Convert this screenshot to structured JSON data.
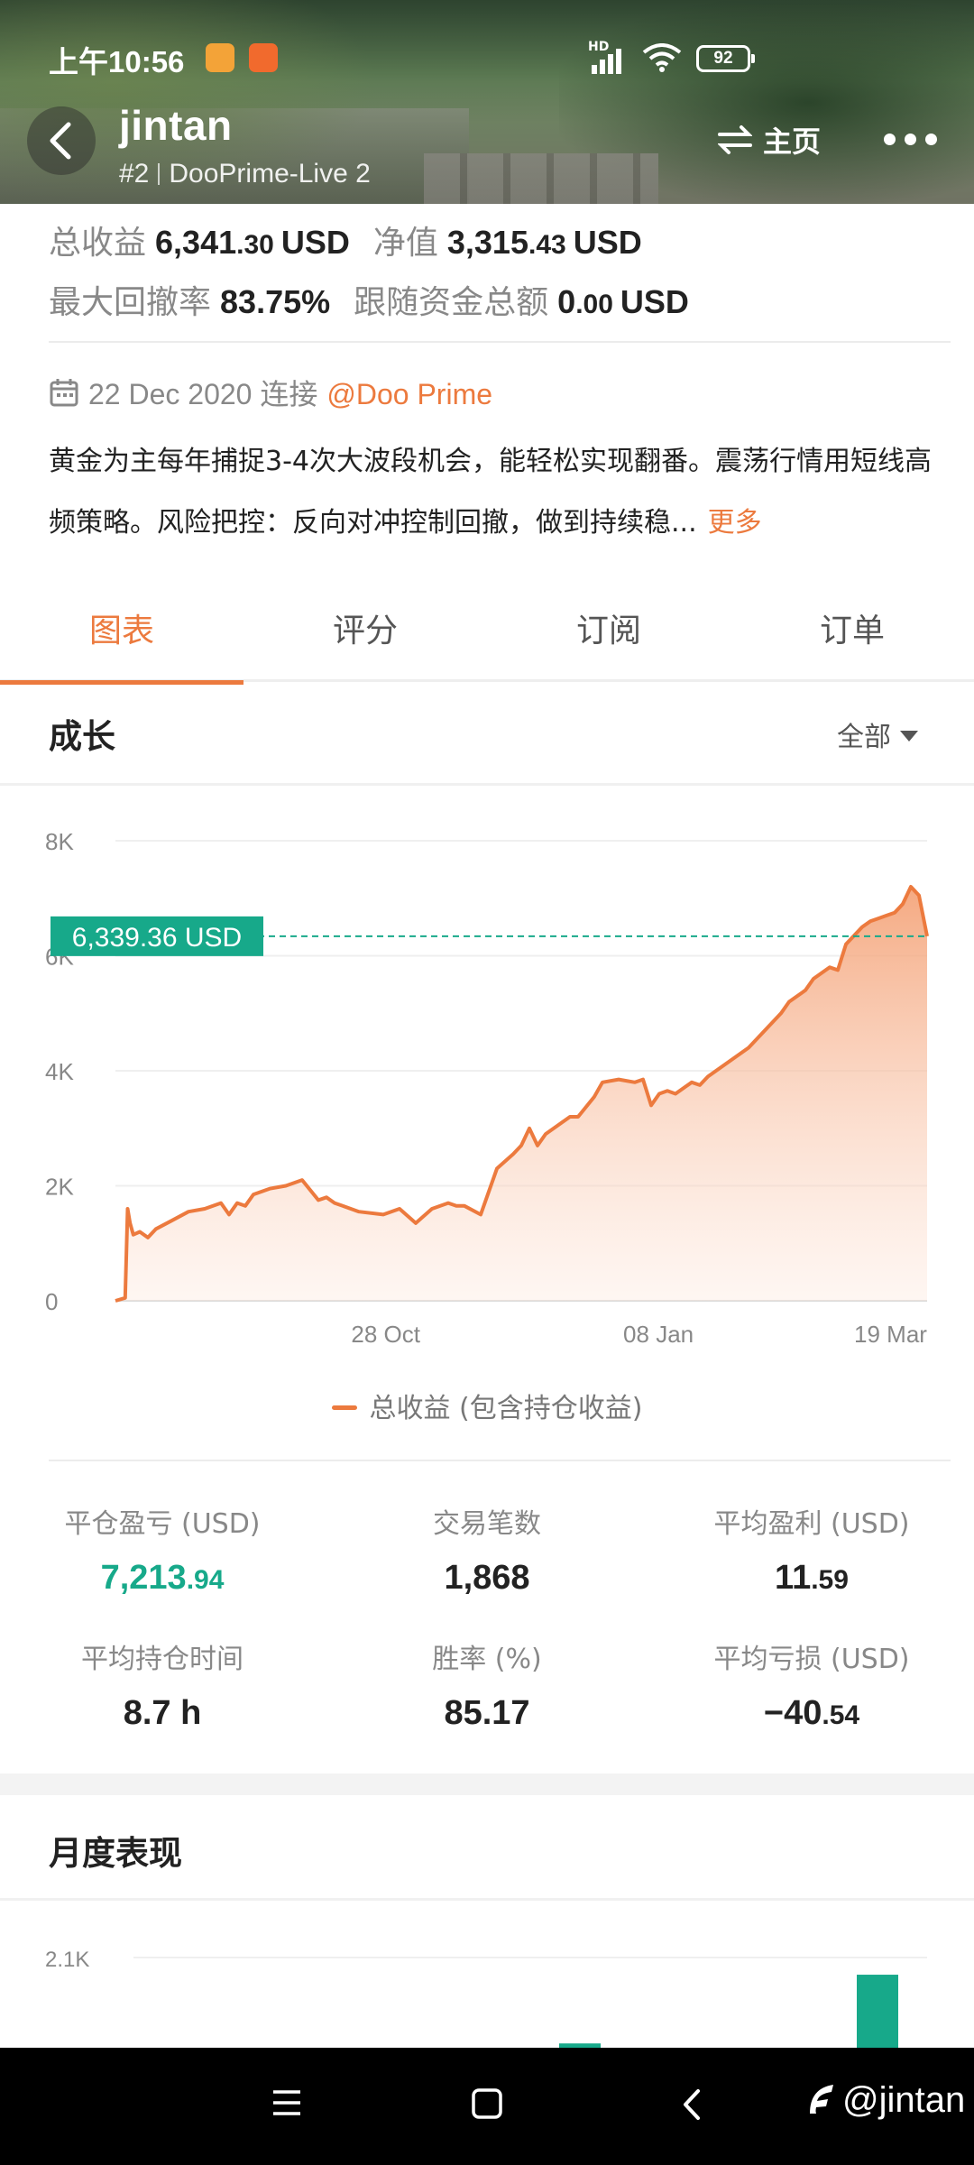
{
  "status_bar": {
    "time": "上午10:56",
    "hd": "HD",
    "battery": "92"
  },
  "header": {
    "name": "jintan",
    "rank": "#2",
    "account": "DooPrime-Live 2",
    "home_label": "主页"
  },
  "summary": {
    "total_profit_label": "总收益",
    "total_profit_int": "6,341",
    "total_profit_dec": ".30",
    "total_profit_unit": "USD",
    "equity_label": "净值",
    "equity_int": "3,315",
    "equity_dec": ".43",
    "equity_unit": "USD",
    "max_drawdown_label": "最大回撤率",
    "max_drawdown": "83.75%",
    "follow_funds_label": "跟随资金总额",
    "follow_funds_int": "0",
    "follow_funds_dec": ".00",
    "follow_funds_unit": "USD"
  },
  "connection": {
    "date": "22 Dec 2020",
    "connected": "连接",
    "broker": "@Doo Prime"
  },
  "description": {
    "text": "黄金为主每年捕捉3-4次大波段机会，能轻松实现翻番。震荡行情用短线高频策略。风险把控：反向对冲控制回撤，做到持续稳...",
    "more": "更多"
  },
  "tabs": [
    "图表",
    "评分",
    "订阅",
    "订单"
  ],
  "growth": {
    "title": "成长",
    "filter": "全部"
  },
  "chart_data": {
    "type": "area",
    "title": "",
    "xlabel": "",
    "ylabel": "",
    "ylim": [
      0,
      8000
    ],
    "yticks": [
      "0",
      "2K",
      "4K",
      "6K",
      "8K"
    ],
    "x_ticks": [
      "28 Oct",
      "08 Jan",
      "19 Mar"
    ],
    "grid": true,
    "current_value_label": "6,339.36 USD",
    "current_value": 6339.36,
    "series": [
      {
        "name": "总收益 (包含持仓收益)",
        "color": "#ec7a3e",
        "x": [
          0,
          0.012,
          0.015,
          0.018,
          0.022,
          0.03,
          0.04,
          0.05,
          0.07,
          0.09,
          0.11,
          0.13,
          0.14,
          0.15,
          0.16,
          0.17,
          0.19,
          0.21,
          0.23,
          0.25,
          0.26,
          0.27,
          0.28,
          0.3,
          0.33,
          0.35,
          0.37,
          0.39,
          0.41,
          0.42,
          0.43,
          0.45,
          0.47,
          0.49,
          0.5,
          0.51,
          0.52,
          0.53,
          0.55,
          0.56,
          0.57,
          0.59,
          0.6,
          0.62,
          0.64,
          0.65,
          0.66,
          0.67,
          0.68,
          0.69,
          0.7,
          0.71,
          0.72,
          0.73,
          0.75,
          0.77,
          0.78,
          0.8,
          0.82,
          0.83,
          0.85,
          0.86,
          0.88,
          0.89,
          0.9,
          0.92,
          0.93,
          0.94,
          0.95,
          0.96,
          0.97,
          0.98,
          0.99,
          1.0
        ],
        "values": [
          0,
          50,
          1600,
          1350,
          1150,
          1200,
          1100,
          1250,
          1400,
          1550,
          1600,
          1700,
          1500,
          1700,
          1650,
          1850,
          1950,
          2000,
          2100,
          1750,
          1800,
          1700,
          1650,
          1550,
          1500,
          1600,
          1350,
          1600,
          1700,
          1650,
          1650,
          1500,
          2300,
          2550,
          2700,
          3000,
          2700,
          2900,
          3100,
          3200,
          3200,
          3550,
          3800,
          3850,
          3800,
          3850,
          3400,
          3600,
          3650,
          3600,
          3700,
          3800,
          3750,
          3900,
          4100,
          4300,
          4400,
          4700,
          5000,
          5200,
          5400,
          5600,
          5800,
          5750,
          6200,
          6500,
          6600,
          6650,
          6700,
          6750,
          6900,
          7200,
          7050,
          6339
        ]
      }
    ]
  },
  "metrics": [
    {
      "label": "平仓盈亏 (USD)",
      "int": "7,213",
      "dec": ".94",
      "green": true
    },
    {
      "label": "交易笔数",
      "int": "1,868",
      "dec": ""
    },
    {
      "label": "平均盈利 (USD)",
      "int": "11",
      "dec": ".59"
    },
    {
      "label": "平均持仓时间",
      "int": "8.7 h",
      "dec": ""
    },
    {
      "label": "胜率 (%)",
      "int": "85.17",
      "dec": ""
    },
    {
      "label": "平均亏损 (USD)",
      "int": "−40",
      "dec": ".54"
    }
  ],
  "monthly": {
    "title": "月度表现",
    "ytick": "2.1K",
    "bar_color": "#17a98a",
    "bars": [
      {
        "value": 1100
      },
      {
        "value": 1900
      }
    ]
  },
  "watermark": "@jintan"
}
